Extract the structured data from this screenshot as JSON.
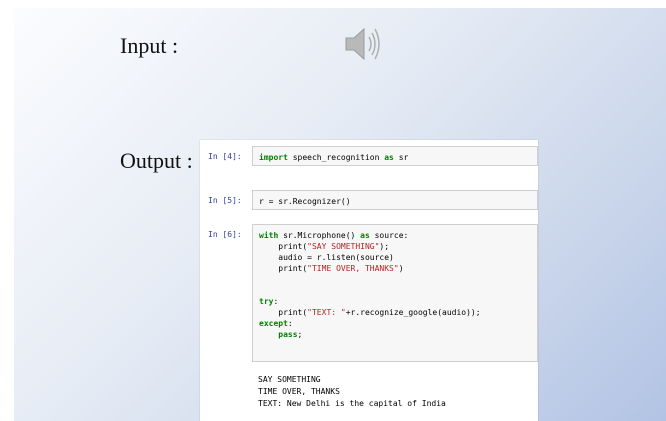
{
  "slide": {
    "input_label": "Input :",
    "output_label": "Output :",
    "speaker_icon": "speaker-volume-icon"
  },
  "notebook": {
    "cells": [
      {
        "prompt": "In [4]:",
        "code": {
          "l1_kw1": "import",
          "l1_mid": " speech_recognition ",
          "l1_kw2": "as",
          "l1_end": " sr"
        }
      },
      {
        "prompt": "In [5]:",
        "code": {
          "l1": "r = sr.Recognizer()"
        }
      },
      {
        "prompt": "In [6]:",
        "code": {
          "l1_kw1": "with",
          "l1_mid": " sr.Microphone() ",
          "l1_kw2": "as",
          "l1_end": " source:",
          "l2_a": "    print(",
          "l2_str": "\"SAY SOMETHING\"",
          "l2_b": ");",
          "l3": "    audio = r.listen(source)",
          "l4_a": "    print(",
          "l4_str": "\"TIME OVER, THANKS\"",
          "l4_b": ")",
          "l7_kw": "try",
          "l7_b": ":",
          "l8_a": "    print(",
          "l8_str": "\"TEXT: \"",
          "l8_b": "+r.recognize_google(audio));",
          "l9_kw": "except",
          "l9_b": ":",
          "l10_kw": "pass",
          "l10_b": ";"
        }
      }
    ],
    "output_lines": [
      "SAY SOMETHING",
      "TIME OVER, THANKS",
      "TEXT: New Delhi is the capital of India"
    ]
  }
}
